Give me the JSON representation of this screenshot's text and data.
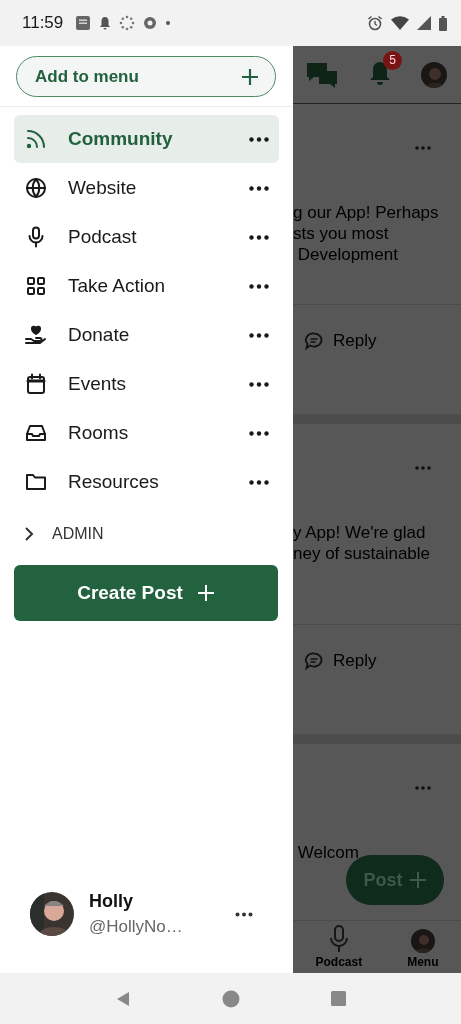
{
  "status_bar": {
    "time": "11:59"
  },
  "drawer": {
    "add_button": {
      "label": "Add to menu"
    },
    "items": [
      {
        "label": "Community",
        "selected": true
      },
      {
        "label": "Website",
        "selected": false
      },
      {
        "label": "Podcast",
        "selected": false
      },
      {
        "label": "Take Action",
        "selected": false
      },
      {
        "label": "Donate",
        "selected": false
      },
      {
        "label": "Events",
        "selected": false
      },
      {
        "label": "Rooms",
        "selected": false
      },
      {
        "label": "Resources",
        "selected": false
      }
    ],
    "admin": {
      "label": "ADMIN",
      "expanded": false
    },
    "create_button": {
      "label": "Create Post"
    },
    "profile": {
      "name": "Holly",
      "handle": "@HollyNo…"
    }
  },
  "background": {
    "notification_count": "5",
    "posts": [
      {
        "lines": [
          "g our App! Perhaps",
          "sts you most",
          " Development"
        ],
        "reply": "Reply"
      },
      {
        "lines": [
          "y App! We're glad",
          "ney of sustainable"
        ],
        "reply": "Reply"
      },
      {
        "lines": [
          " Welcom"
        ]
      }
    ],
    "fab": {
      "label": "Post"
    },
    "bottom_tabs": [
      {
        "label": "Podcast"
      },
      {
        "label": "Menu"
      }
    ]
  }
}
